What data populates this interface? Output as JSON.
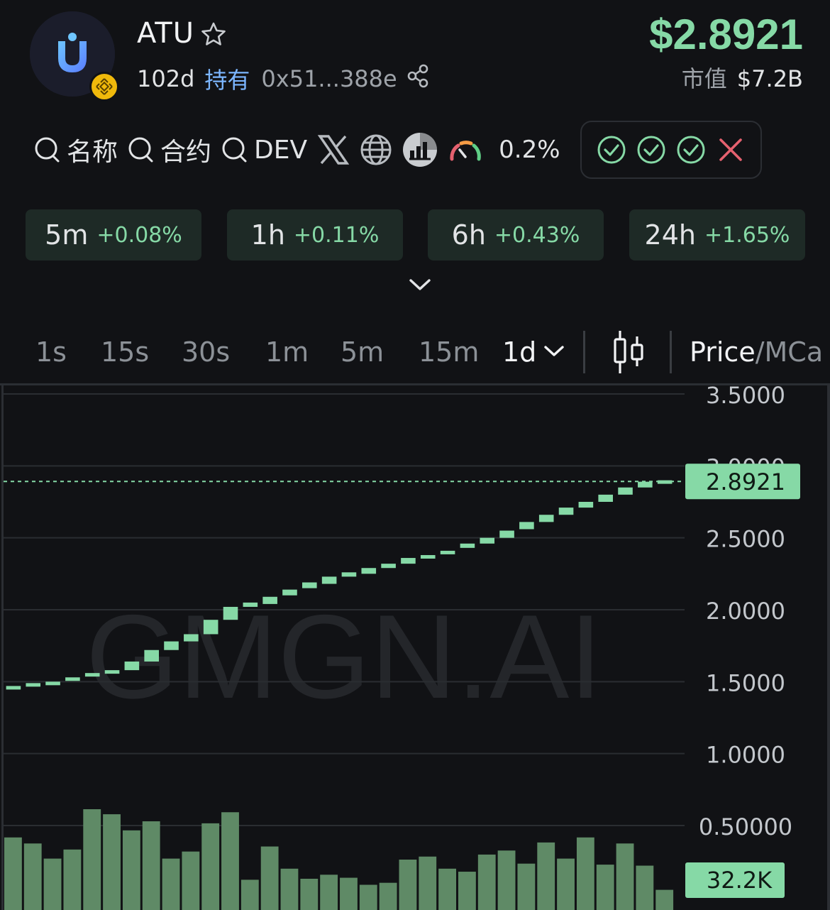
{
  "header": {
    "token_name": "ATU",
    "age": "102d",
    "holders_label": "持有",
    "address": "0x51...388e",
    "price": "$2.8921",
    "market_cap_label": "市值",
    "market_cap": "$7.2B",
    "logo_letter": "U",
    "chain_icon": "bnb-chain-icon"
  },
  "search": {
    "items": [
      "名称",
      "合约",
      "DEV"
    ],
    "tax_percent": "0.2%"
  },
  "security_checks": [
    "pass",
    "pass",
    "pass",
    "fail"
  ],
  "changes": [
    {
      "tf": "5m",
      "change": "+0.08%"
    },
    {
      "tf": "1h",
      "change": "+0.11%"
    },
    {
      "tf": "6h",
      "change": "+0.43%"
    },
    {
      "tf": "24h",
      "change": "+1.65%"
    }
  ],
  "timeframes": [
    "1s",
    "15s",
    "30s",
    "1m",
    "5m",
    "15m",
    "1d"
  ],
  "active_timeframe": "1d",
  "chart_toggle": {
    "primary": "Price",
    "secondary": "/MCa"
  },
  "colors": {
    "up": "#86d9a6",
    "volume": "#5f8a66",
    "accent_blue": "#7cb6ff",
    "fail": "#e5616f",
    "background": "#111215"
  },
  "chart_data": {
    "type": "candlestick",
    "watermark": "GMGN.AI",
    "ylim": [
      0.5,
      3.5
    ],
    "y_ticks": [
      "3.5000",
      "3.0000",
      "2.5000",
      "2.0000",
      "1.5000",
      "1.0000",
      "0.50000"
    ],
    "current_price": 2.8921,
    "current_price_label": "2.8921",
    "volume_label": "32.2K",
    "candles": [
      [
        1.45,
        1.47
      ],
      [
        1.47,
        1.49
      ],
      [
        1.49,
        1.5
      ],
      [
        1.51,
        1.53
      ],
      [
        1.54,
        1.56
      ],
      [
        1.56,
        1.58
      ],
      [
        1.58,
        1.64
      ],
      [
        1.64,
        1.72
      ],
      [
        1.72,
        1.78
      ],
      [
        1.78,
        1.83
      ],
      [
        1.83,
        1.93
      ],
      [
        1.93,
        2.02
      ],
      [
        2.02,
        2.05
      ],
      [
        2.04,
        2.09
      ],
      [
        2.1,
        2.14
      ],
      [
        2.15,
        2.19
      ],
      [
        2.18,
        2.23
      ],
      [
        2.23,
        2.26
      ],
      [
        2.25,
        2.29
      ],
      [
        2.29,
        2.32
      ],
      [
        2.32,
        2.36
      ],
      [
        2.36,
        2.38
      ],
      [
        2.39,
        2.41
      ],
      [
        2.43,
        2.46
      ],
      [
        2.46,
        2.5
      ],
      [
        2.5,
        2.55
      ],
      [
        2.56,
        2.61
      ],
      [
        2.61,
        2.66
      ],
      [
        2.66,
        2.71
      ],
      [
        2.71,
        2.75
      ],
      [
        2.75,
        2.8
      ],
      [
        2.8,
        2.85
      ],
      [
        2.85,
        2.89
      ],
      [
        2.885,
        2.9
      ]
    ],
    "volumes": [
      0.72,
      0.66,
      0.51,
      0.6,
      1.0,
      0.95,
      0.79,
      0.88,
      0.51,
      0.58,
      0.86,
      0.97,
      0.3,
      0.63,
      0.41,
      0.31,
      0.35,
      0.32,
      0.25,
      0.27,
      0.5,
      0.53,
      0.41,
      0.38,
      0.55,
      0.59,
      0.46,
      0.67,
      0.51,
      0.72,
      0.45,
      0.66,
      0.44,
      0.2
    ]
  }
}
